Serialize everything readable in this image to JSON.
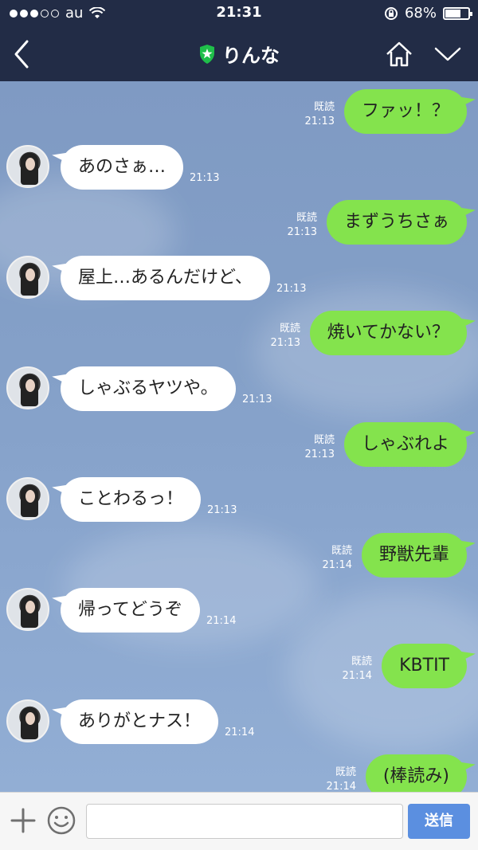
{
  "status": {
    "carrier": "au",
    "time": "21:31",
    "battery": "68%",
    "battery_level": 0.68
  },
  "header": {
    "contact_name": "りんな"
  },
  "messages": [
    {
      "from": "me",
      "text": "ファッ！？",
      "read": "既読",
      "time": "21:13"
    },
    {
      "from": "them",
      "text": "あのさぁ…",
      "time": "21:13"
    },
    {
      "from": "me",
      "text": "まずうちさぁ",
      "read": "既読",
      "time": "21:13"
    },
    {
      "from": "them",
      "text": "屋上…あるんだけど、",
      "time": "21:13"
    },
    {
      "from": "me",
      "text": "焼いてかない？",
      "read": "既読",
      "time": "21:13"
    },
    {
      "from": "them",
      "text": "しゃぶるヤツや。",
      "time": "21:13"
    },
    {
      "from": "me",
      "text": "しゃぶれよ",
      "read": "既読",
      "time": "21:13"
    },
    {
      "from": "them",
      "text": "ことわるっ！",
      "time": "21:13"
    },
    {
      "from": "me",
      "text": "野獣先輩",
      "read": "既読",
      "time": "21:14"
    },
    {
      "from": "them",
      "text": "帰ってどうぞ",
      "time": "21:14"
    },
    {
      "from": "me",
      "text": "KBTIT",
      "read": "既読",
      "time": "21:14"
    },
    {
      "from": "them",
      "text": "ありがとナス！",
      "time": "21:14"
    },
    {
      "from": "me",
      "text": "(棒読み)",
      "read": "既読",
      "time": "21:14"
    }
  ],
  "composer": {
    "send_label": "送信",
    "input_value": ""
  },
  "colors": {
    "header": "#222c46",
    "outgoing_bubble": "#84e34d",
    "incoming_bubble": "#ffffff",
    "send_button": "#5b8fe0"
  }
}
